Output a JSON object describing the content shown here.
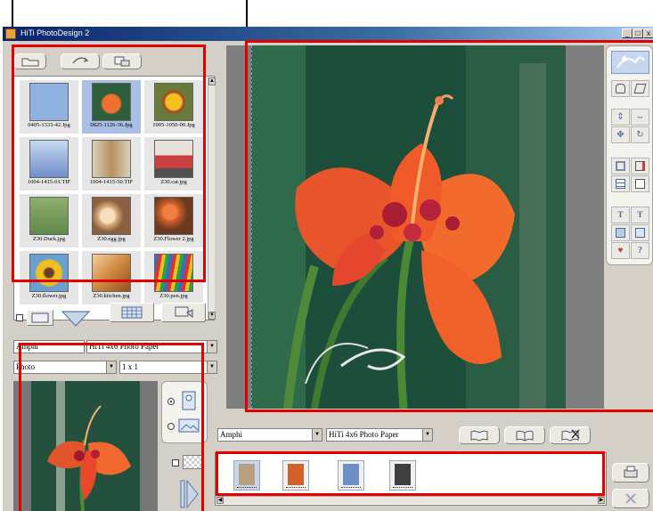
{
  "window": {
    "title": "HiTi PhotoDesign 2",
    "buttons": {
      "minimize": "_",
      "maximize": "□",
      "close": "x"
    }
  },
  "thumbnails": [
    {
      "caption": "0405-1333-42.Jpg",
      "selected": false,
      "color": "#8fb2e0"
    },
    {
      "caption": "0825-1126-36.Jpg",
      "selected": true,
      "color": "#d9502a"
    },
    {
      "caption": "1005-1050-00.Jpg",
      "selected": false,
      "color": "#e7b020"
    },
    {
      "caption": "1004-1415-01.TIF",
      "selected": false,
      "color": "#6f8fc9"
    },
    {
      "caption": "1004-1415-50.TIF",
      "selected": false,
      "color": "#b89060"
    },
    {
      "caption": "Z30.car.jpg",
      "selected": false,
      "color": "#c84040"
    },
    {
      "caption": "Z30.Duck.jpg",
      "selected": false,
      "color": "#5f8a4a"
    },
    {
      "caption": "Z30.egg.jpg",
      "selected": false,
      "color": "#e0b080"
    },
    {
      "caption": "Z30.Flower 2.jpg",
      "selected": false,
      "color": "#d2602a"
    },
    {
      "caption": "Z30.flower.jpg",
      "selected": false,
      "color": "#f0c020"
    },
    {
      "caption": "Z30.kitchen.jpg",
      "selected": false,
      "color": "#d08840"
    },
    {
      "caption": "Z30.pen.jpg",
      "selected": false,
      "color": "#3070c0"
    }
  ],
  "print_settings": {
    "printer": "Amphi",
    "paper": "HiTi 4x6 Photo Paper",
    "type": "Photo",
    "layout": "1 x 1",
    "orientation": "portrait"
  },
  "bottom_bar": {
    "printer": "Amphi",
    "paper": "HiTi 4x6 Photo Paper",
    "selected_thumb": 0
  },
  "filmstrip_colors": [
    "#b6a080",
    "#d2602a",
    "#6f8fc9",
    "#404040"
  ]
}
